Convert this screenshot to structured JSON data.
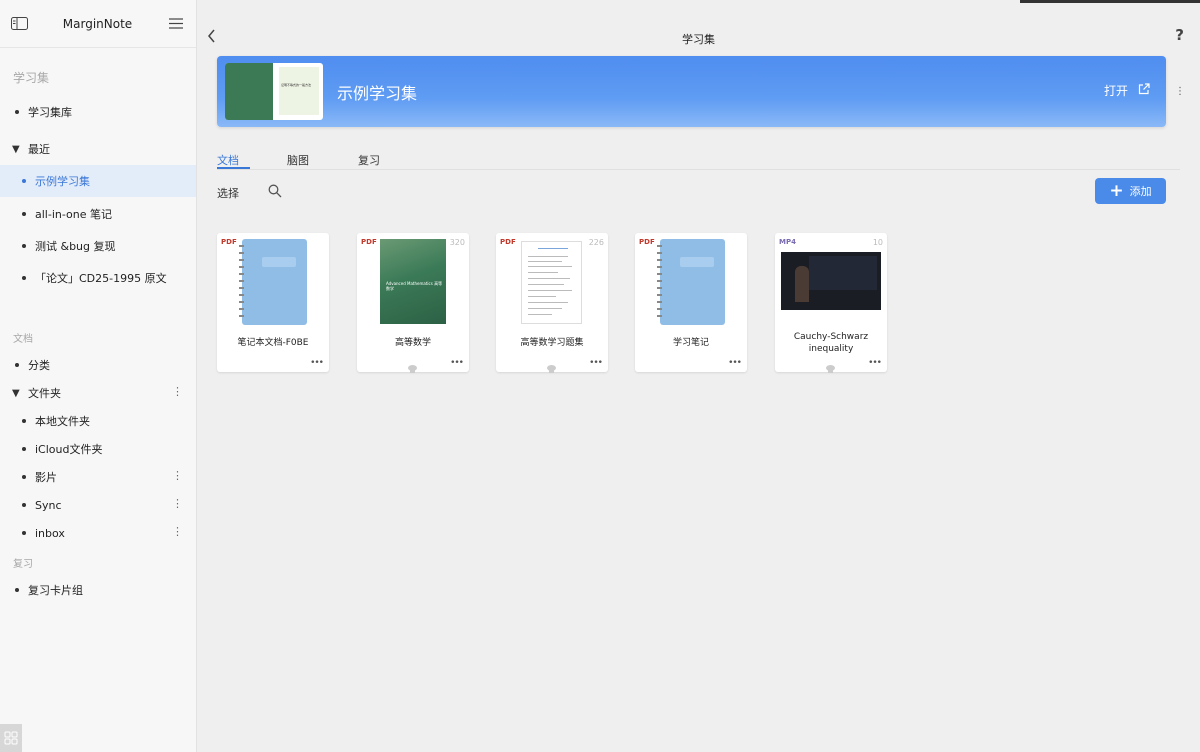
{
  "app": {
    "title": "MarginNote"
  },
  "sidebar": {
    "sections": {
      "study": "学习集",
      "docs": "文档",
      "review": "复习"
    },
    "study_items": {
      "library": "学习集库",
      "recent": "最近",
      "recent_items": [
        "示例学习集",
        "all-in-one 笔记",
        "测试 &bug 复现",
        "「论文」CD25-1995 原文"
      ]
    },
    "doc_items": {
      "category": "分类",
      "folders": "文件夹",
      "folder_items": [
        "本地文件夹",
        "iCloud文件夹",
        "影片",
        "Sync",
        "inbox"
      ]
    },
    "review_items": {
      "cards": "复习卡片组"
    },
    "active_item": "示例学习集"
  },
  "header": {
    "title": "学习集",
    "help": "?"
  },
  "banner": {
    "title": "示例学习集",
    "open_label": "打开",
    "thumb_text": "证明不等式的一般方法"
  },
  "tabs": [
    "文档",
    "脑图",
    "复习"
  ],
  "active_tab": "文档",
  "toolbar": {
    "select_label": "选择",
    "add_label": "添加"
  },
  "documents": [
    {
      "type": "PDF",
      "count": "",
      "name": "笔记本文档-F0BE"
    },
    {
      "type": "PDF",
      "count": "320",
      "name": "高等数学",
      "cover_text": "Advanced Mathematics 高等数学"
    },
    {
      "type": "PDF",
      "count": "226",
      "name": "高等数学习题集"
    },
    {
      "type": "PDF",
      "count": "",
      "name": "学习笔记"
    },
    {
      "type": "MP4",
      "count": "10",
      "name": "Cauchy-Schwarz inequality"
    }
  ],
  "colors": {
    "accent": "#3a78d8",
    "banner": "#4f8df0",
    "pdf_label": "#c0392b",
    "mp4_label": "#7a6bb0"
  }
}
